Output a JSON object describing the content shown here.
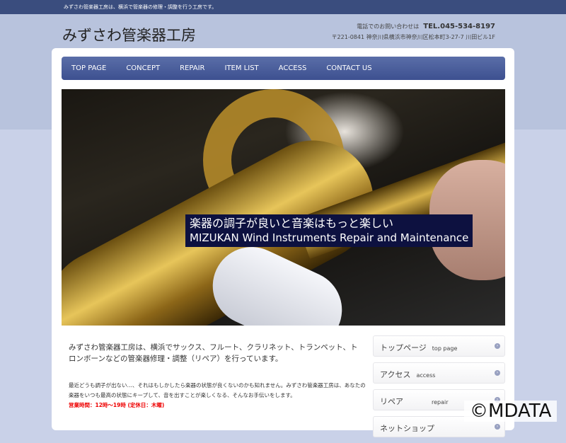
{
  "topbar": {
    "text": "みずさわ管楽器工房は、横浜で管楽器の修理・調整を行う工房です。"
  },
  "header": {
    "logo": "みずさわ管楽器工房",
    "contact_label": "電話でのお問い合わせは",
    "tel": "TEL.045-534-8197",
    "address": "〒221-0841 神奈川県横浜市神奈川区松本町3-27-7 川田ビル1F"
  },
  "nav": [
    "TOP PAGE",
    "CONCEPT",
    "REPAIR",
    "ITEM LIST",
    "ACCESS",
    "CONTACT US"
  ],
  "hero": {
    "caption_jp": "楽器の調子が良いと音楽はもっと楽しい",
    "caption_en": "MIZUKAN Wind Instruments Repair and Maintenance"
  },
  "main": {
    "intro": "みずさわ管楽器工房は、横浜でサックス、フルート、クラリネット、トランペット、トロンボーンなどの管楽器修理・調整（リペア）を行っています。",
    "body": "最近どうも調子が出ない…、それはもしかしたら楽器の状態が良くないのかも知れません。みずさわ管楽器工房は、あなたの楽器をいつも最高の状態にキープして、音を出すことが楽しくなる、そんなお手伝いをします。",
    "hours": "営業時間：12時〜19時 (定休日：木曜)"
  },
  "sidebar": [
    {
      "jp": "トップページ",
      "en": "top page"
    },
    {
      "jp": "アクセス",
      "en": "access"
    },
    {
      "jp": "リペア",
      "en": "repair"
    },
    {
      "jp": "ネットショップ",
      "en": ""
    }
  ],
  "watermark": "©MDATA"
}
